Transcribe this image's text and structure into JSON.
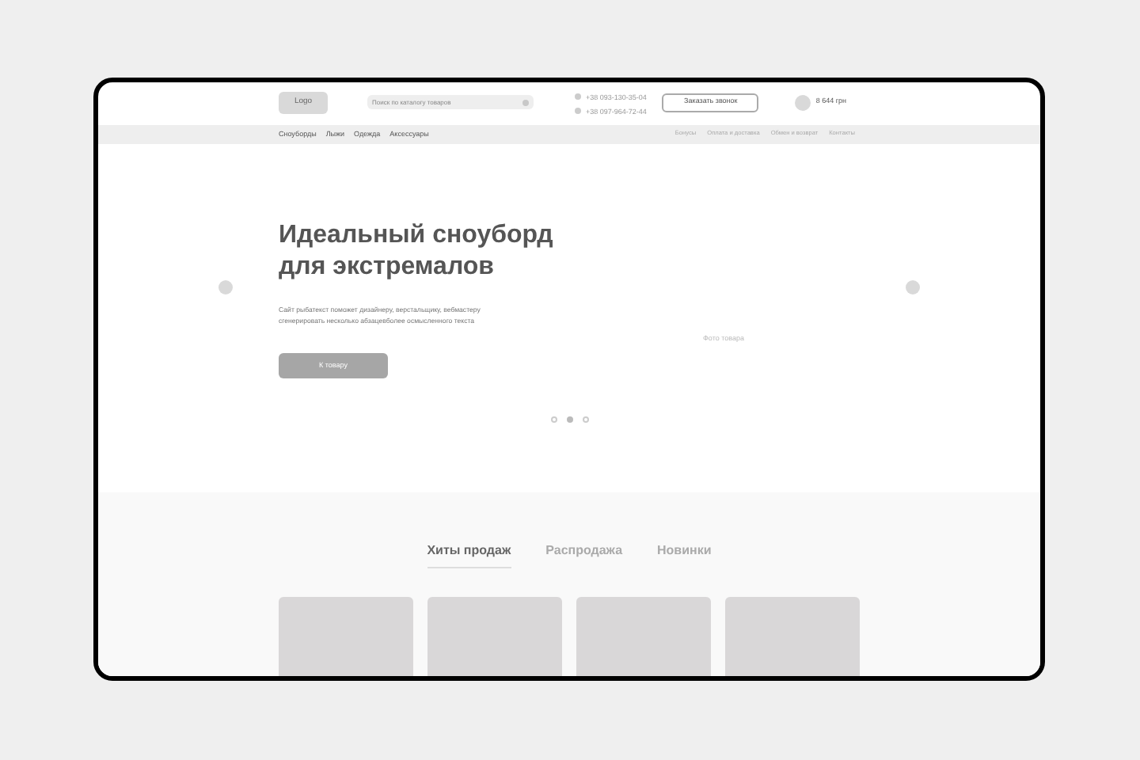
{
  "header": {
    "logo": "Logo",
    "search": {
      "placeholder": "Поиск по каталогу товаров"
    },
    "phones": [
      "+38 093-130-35-04",
      "+38 097-964-72-44"
    ],
    "callback_button": "Заказать звонок",
    "cart_total": "8 644 грн"
  },
  "nav": {
    "categories": [
      "Сноуборды",
      "Лыжи",
      "Одежда",
      "Аксессуары"
    ],
    "links": [
      "Бонусы",
      "Оплата и доставка",
      "Обмен и возврат",
      "Контакты"
    ]
  },
  "hero": {
    "title": "Идеальный сноуборд для экстремалов",
    "text": "Сайт рыбатекст поможет дизайнеру, верстальщику, вебмастеру сгенерировать несколько абзацевболее осмысленного текста",
    "button": "К товару",
    "photo_label": "Фото товара",
    "slides": [
      {
        "selected": false
      },
      {
        "selected": true
      },
      {
        "selected": false
      }
    ]
  },
  "tabs": [
    {
      "label": "Хиты продаж",
      "selected": true
    },
    {
      "label": "Распродажа",
      "selected": false
    },
    {
      "label": "Новинки",
      "selected": false
    }
  ]
}
